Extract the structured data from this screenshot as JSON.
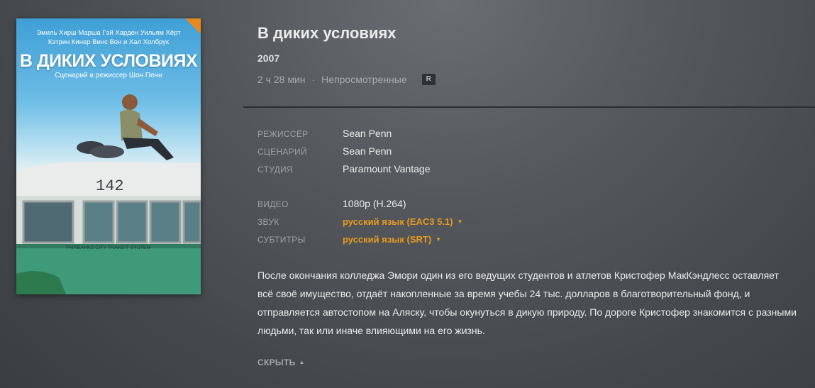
{
  "poster": {
    "cast_line1": "Эмиль Хирш  Марша Гэй Харден  Уильям Хёрт",
    "cast_line2": "Кэтрин Кинер  Винс Вон и Хал Холбрук",
    "title": "В ДИКИХ УСЛОВИЯХ",
    "credits": "Сценарий и режиссер Шон Пенн",
    "bus_number": "142",
    "bus_text": "FAIRBANKS CITY TRANSIT SYSTEM"
  },
  "movie": {
    "title": "В диких условиях",
    "year": "2007",
    "duration": "2 ч 28 мин",
    "separator": "·",
    "watch_status": "Непросмотренные",
    "rating": "R"
  },
  "details": {
    "director_label": "РЕЖИССЁР",
    "director": "Sean Penn",
    "writer_label": "СЦЕНАРИЙ",
    "writer": "Sean Penn",
    "studio_label": "СТУДИЯ",
    "studio": "Paramount Vantage",
    "video_label": "ВИДЕО",
    "video": "1080p (H.264)",
    "audio_label": "ЗВУК",
    "audio": "русский язык (EAC3 5.1)",
    "subtitles_label": "СУБТИТРЫ",
    "subtitles": "русский язык (SRT)"
  },
  "summary": "После окончания колледжа Эмори один из его ведущих студентов и атлетов Кристофер МакКэндлесс оставляет всё своё имущество, отдаёт накопленные за время учебы 24 тыс. долларов в благотворительный фонд, и отправляется автостопом на Аляску, чтобы окунуться в дикую природу. По дороге Кристофер знакомится с разными людьми, так или иначе влияющими на его жизнь.",
  "collapse_label": "СКРЫТЬ",
  "colors": {
    "accent": "#e89a1f",
    "background": "#55595d",
    "label": "#9ea2a5"
  },
  "icons": {
    "dropdown": "caret-down-icon",
    "collapse": "caret-up-icon"
  }
}
